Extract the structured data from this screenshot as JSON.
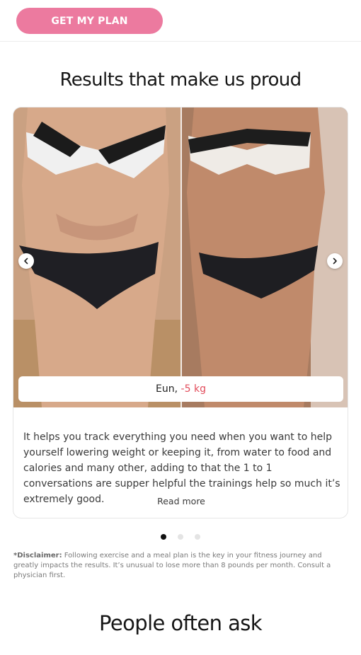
{
  "header": {
    "cta_label": "GET MY PLAN"
  },
  "results": {
    "title": "Results that make us proud",
    "testimonial": {
      "name": "Eun,",
      "loss": "-5 kg",
      "review": "It helps you track everything you need when you want to help yourself lowering weight or keeping it, from water to food and calories and many other, adding to that the 1 to 1 conversations are supper helpful the trainings help so much it’s extremely good.",
      "read_more": "Read more"
    },
    "carousel": {
      "slide_count": 3,
      "active_index": 0
    }
  },
  "disclaimer": {
    "label": "*Disclaimer:",
    "text": " Following exercise and a meal plan is the key in your fitness journey and greatly impacts the results. It’s unusual to lose more than 8 pounds per month. Consult a physician first."
  },
  "faq": {
    "title": "People often ask"
  },
  "colors": {
    "accent": "#ec7a9f",
    "loss": "#e24d5c"
  },
  "icons": {
    "prev": "chevron-left-icon",
    "next": "chevron-right-icon"
  }
}
